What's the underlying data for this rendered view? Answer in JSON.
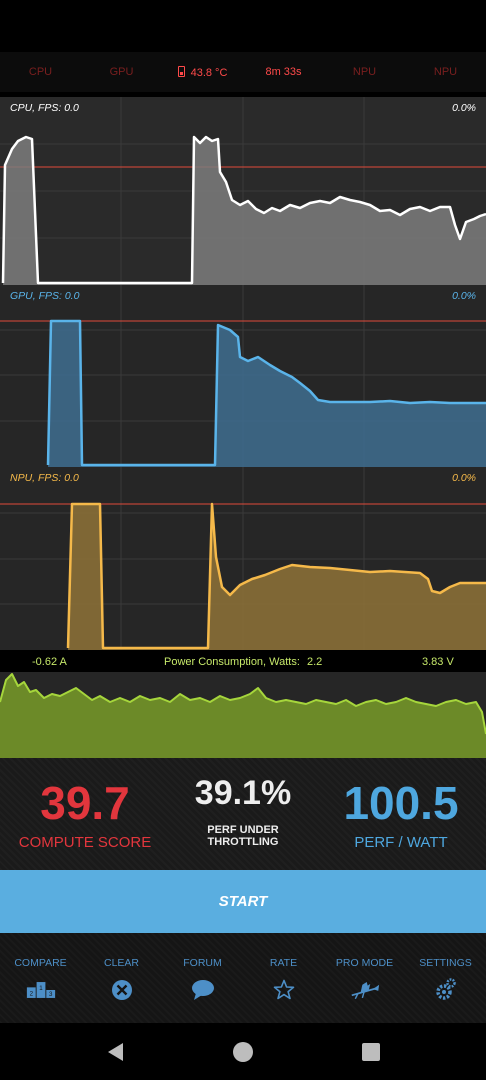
{
  "topbar": {
    "cpu_label": "CPU",
    "gpu_label": "GPU",
    "temperature": "43.8 °C",
    "elapsed": "8m 33s",
    "npu_label_1": "NPU",
    "npu_label_2": "NPU"
  },
  "graphs": {
    "cpu": {
      "label": "CPU, FPS:  0.0",
      "percent": "0.0%",
      "color": "#ffffff"
    },
    "gpu": {
      "label": "GPU, FPS:  0.0",
      "percent": "0.0%",
      "color": "#5ab4ea"
    },
    "npu": {
      "label": "NPU, FPS:  0.0",
      "percent": "0.0%",
      "color": "#f5b94a"
    }
  },
  "power": {
    "current": "-0.62 A",
    "title": "Power Consumption, Watts:",
    "watts": "2.2",
    "voltage": "3.83 V",
    "color": "#a6d63c"
  },
  "scores": {
    "compute": {
      "value": "39.7",
      "label": "COMPUTE SCORE",
      "color": "#e2363d"
    },
    "throttling": {
      "value": "39.1%",
      "label_line1": "PERF UNDER",
      "label_line2": "THROTTLING",
      "color": "#eeeeee"
    },
    "perf_watt": {
      "value": "100.5",
      "label": "PERF / WATT",
      "color": "#4ea7df"
    }
  },
  "start_button": {
    "label": "START"
  },
  "nav": [
    {
      "label": "COMPARE",
      "icon": "podium-icon"
    },
    {
      "label": "CLEAR",
      "icon": "clear-circle-icon"
    },
    {
      "label": "FORUM",
      "icon": "chat-bubble-icon"
    },
    {
      "label": "RATE",
      "icon": "star-icon"
    },
    {
      "label": "PRO MODE",
      "icon": "witch-icon"
    },
    {
      "label": "SETTINGS",
      "icon": "gears-icon"
    }
  ]
}
